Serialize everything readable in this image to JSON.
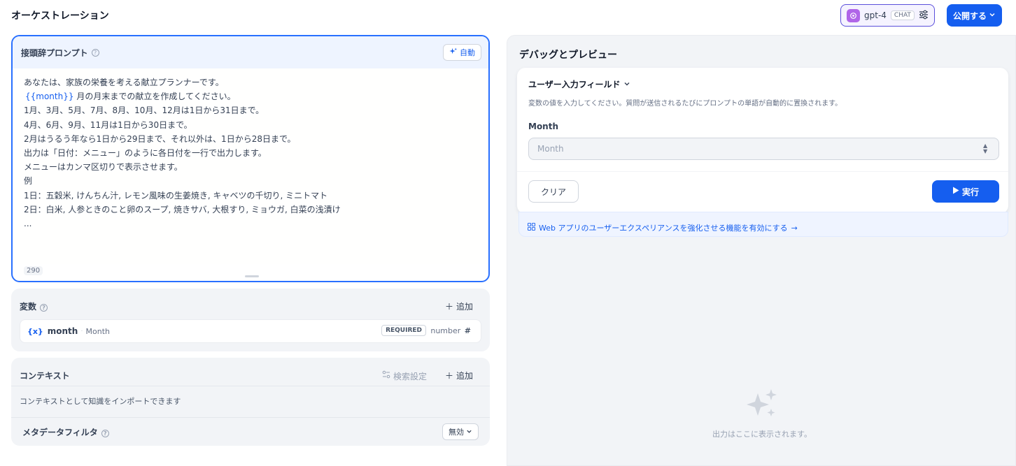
{
  "header": {
    "title": "オーケストレーション",
    "model": {
      "name": "gpt-4",
      "mode": "CHAT"
    },
    "publish_label": "公開する"
  },
  "prompt": {
    "title": "接頭辞プロンプト",
    "auto_label": "自動",
    "lines": [
      "あなたは、家族の栄養を考える献立プランナーです。",
      "{{month}}",
      "月の月末までの献立を作成してください。",
      "1月、3月、5月、7月、8月、10月、12月は1日から31日まで。",
      "4月、6月、9月、11月は1日から30日まで。",
      "2月はうるう年なら1日から29日まで、それ以外は、1日から28日まで。",
      "出力は「日付：メニュー」のように各日付を一行で出力します。",
      "メニューはカンマ区切りで表示させます。",
      "例",
      "1日：五穀米, けんちん汁, レモン風味の生姜焼き, キャベツの千切り, ミニトマト",
      "2日：白米, 人参ときのこと卵のスープ, 焼きサバ, 大根すり, ミョウガ, 白菜の浅漬け",
      "..."
    ],
    "char_count": "290"
  },
  "variables": {
    "title": "変数",
    "add_label": "追加",
    "items": [
      {
        "icon": "{x}",
        "key": "month",
        "label": "Month",
        "required": "REQUIRED",
        "type": "number"
      }
    ]
  },
  "context": {
    "title": "コンテキスト",
    "search_settings_label": "検索設定",
    "add_label": "追加",
    "description": "コンテキストとして知識をインポートできます",
    "metadata_filter_label": "メタデータフィルタ",
    "metadata_filter_value": "無効"
  },
  "debug": {
    "title": "デバッグとプレビュー",
    "input_fields_title": "ユーザー入力フィールド",
    "input_fields_hint": "変数の値を入力してください。質問が送信されるたびにプロンプトの単語が自動的に置換されます。",
    "month_label": "Month",
    "month_placeholder": "Month",
    "clear_label": "クリア",
    "run_label": "実行",
    "web_banner": "Web アプリのユーザーエクスペリアンスを強化させる機能を有効にする",
    "output_placeholder": "出力はここに表示されます。"
  },
  "colors": {
    "accent": "#155eef",
    "model_logo": "#b065e8",
    "panel_bg": "#f2f4f7"
  },
  "icons": [
    "openai-icon",
    "sliders-icon",
    "chevron-down-icon",
    "sparkle-icon",
    "help-icon",
    "plus-icon",
    "variable-icon",
    "hash-icon",
    "search-settings-icon",
    "play-icon",
    "apps-icon",
    "arrow-right-icon"
  ]
}
